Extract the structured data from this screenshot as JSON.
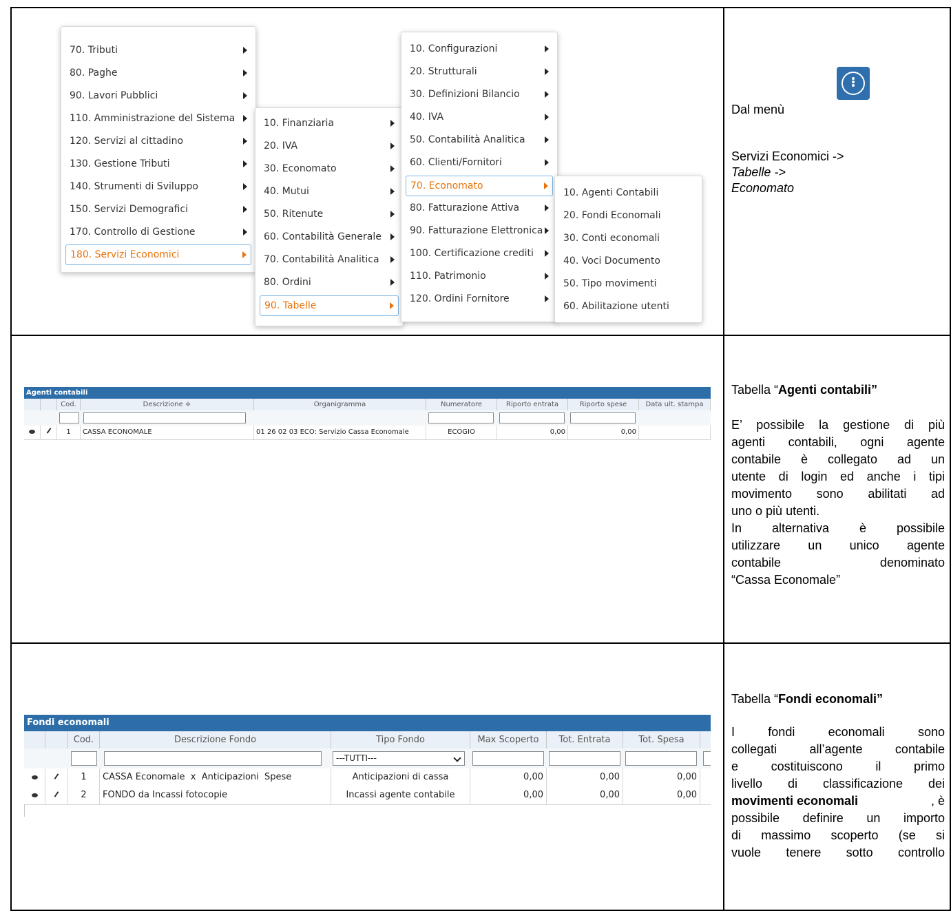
{
  "menu1": {
    "items": [
      {
        "label": "70. Tributi"
      },
      {
        "label": "80. Paghe"
      },
      {
        "label": "90. Lavori Pubblici"
      },
      {
        "label": "110. Amministrazione del Sistema"
      },
      {
        "label": "120. Servizi al cittadino"
      },
      {
        "label": "130. Gestione Tributi"
      },
      {
        "label": "140. Strumenti di Sviluppo"
      },
      {
        "label": "150. Servizi Demografici"
      },
      {
        "label": "170. Controllo di Gestione"
      },
      {
        "label": "180. Servizi Economici"
      }
    ]
  },
  "menu2": {
    "items": [
      {
        "label": "10. Finanziaria"
      },
      {
        "label": "20. IVA"
      },
      {
        "label": "30. Economato"
      },
      {
        "label": "40. Mutui"
      },
      {
        "label": "50. Ritenute"
      },
      {
        "label": "60. Contabilità Generale"
      },
      {
        "label": "70. Contabilità Analitica"
      },
      {
        "label": "80. Ordini"
      },
      {
        "label": "90. Tabelle"
      }
    ]
  },
  "menu3": {
    "items": [
      {
        "label": "10. Configurazioni"
      },
      {
        "label": "20. Strutturali"
      },
      {
        "label": "30. Definizioni Bilancio"
      },
      {
        "label": "40. IVA"
      },
      {
        "label": "50. Contabilità Analitica"
      },
      {
        "label": "60. Clienti/Fornitori"
      },
      {
        "label": "70. Economato"
      },
      {
        "label": "80. Fatturazione Attiva"
      },
      {
        "label": "90. Fatturazione Elettronica"
      },
      {
        "label": "100. Certificazione crediti"
      },
      {
        "label": "110. Patrimonio"
      },
      {
        "label": "120. Ordini Fornitore"
      }
    ]
  },
  "menu4": {
    "items": [
      {
        "label": "10. Agenti Contabili"
      },
      {
        "label": "20. Fondi Economali"
      },
      {
        "label": "30. Conti economali"
      },
      {
        "label": "40. Voci Documento"
      },
      {
        "label": "50. Tipo movimenti"
      },
      {
        "label": "60. Abilitazione utenti"
      }
    ]
  },
  "row1_text": {
    "dal_menu": "Dal menù",
    "path1": "Servizi Economici ->",
    "path2": "Tabelle ->",
    "path3": "Economato"
  },
  "agenti": {
    "title": "Agenti contabili",
    "headers": [
      "Cod.",
      "Descrizione ≑",
      "Organigramma",
      "Numeratore",
      "Riporto entrata",
      "Riporto spese",
      "Data ult. stampa"
    ],
    "row": {
      "cod": "1",
      "descrizione": "CASSA ECONOMALE",
      "organigramma": "01 26 02 03 ECO: Servizio Cassa Economale",
      "numeratore": "ECOGIO",
      "riporto_entrata": "0,00",
      "riporto_spese": "0,00",
      "data": ""
    }
  },
  "row2_text": {
    "title_prefix": "Tabella “",
    "title_bold": "Agenti contabili”",
    "para": [
      "E’ possibile la gestione di più",
      "agenti contabili, ogni agente",
      "contabile è collegato ad un",
      "utente di login ed anche i tipi",
      "movimento sono abilitati ad",
      "uno o più utenti.",
      "In alternativa è possibile",
      "utilizzare un unico agente",
      "contabile denominato",
      "“Cassa Economale”"
    ]
  },
  "fondi": {
    "title": "Fondi economali",
    "headers": [
      "Cod.",
      "Descrizione Fondo",
      "Tipo Fondo",
      "Max Scoperto",
      "Tot. Entrata",
      "Tot. Spesa"
    ],
    "filter_select": "---TUTTI---",
    "rows": [
      {
        "cod": "1",
        "descrizione": "CASSA Economale  x  Anticipazioni  Spese",
        "tipo": "Anticipazioni di cassa",
        "max": "0,00",
        "entrata": "0,00",
        "spesa": "0,00"
      },
      {
        "cod": "2",
        "descrizione": "FONDO da Incassi fotocopie",
        "tipo": "Incassi agente contabile",
        "max": "0,00",
        "entrata": "0,00",
        "spesa": "0,00"
      }
    ]
  },
  "row3_text": {
    "title_prefix": "Tabella “",
    "title_bold": "Fondi economali”",
    "l1": "I fondi economali sono",
    "l2": "collegati all’agente contabile",
    "l3": "e costituiscono il primo",
    "l4": "livello di classificazione dei",
    "l5_bold": "movimenti economali",
    "l5_rest": ", è",
    "l6": "possibile definire un importo",
    "l7": "di massimo scoperto (se si",
    "l8": "vuole tenere sotto controllo"
  }
}
